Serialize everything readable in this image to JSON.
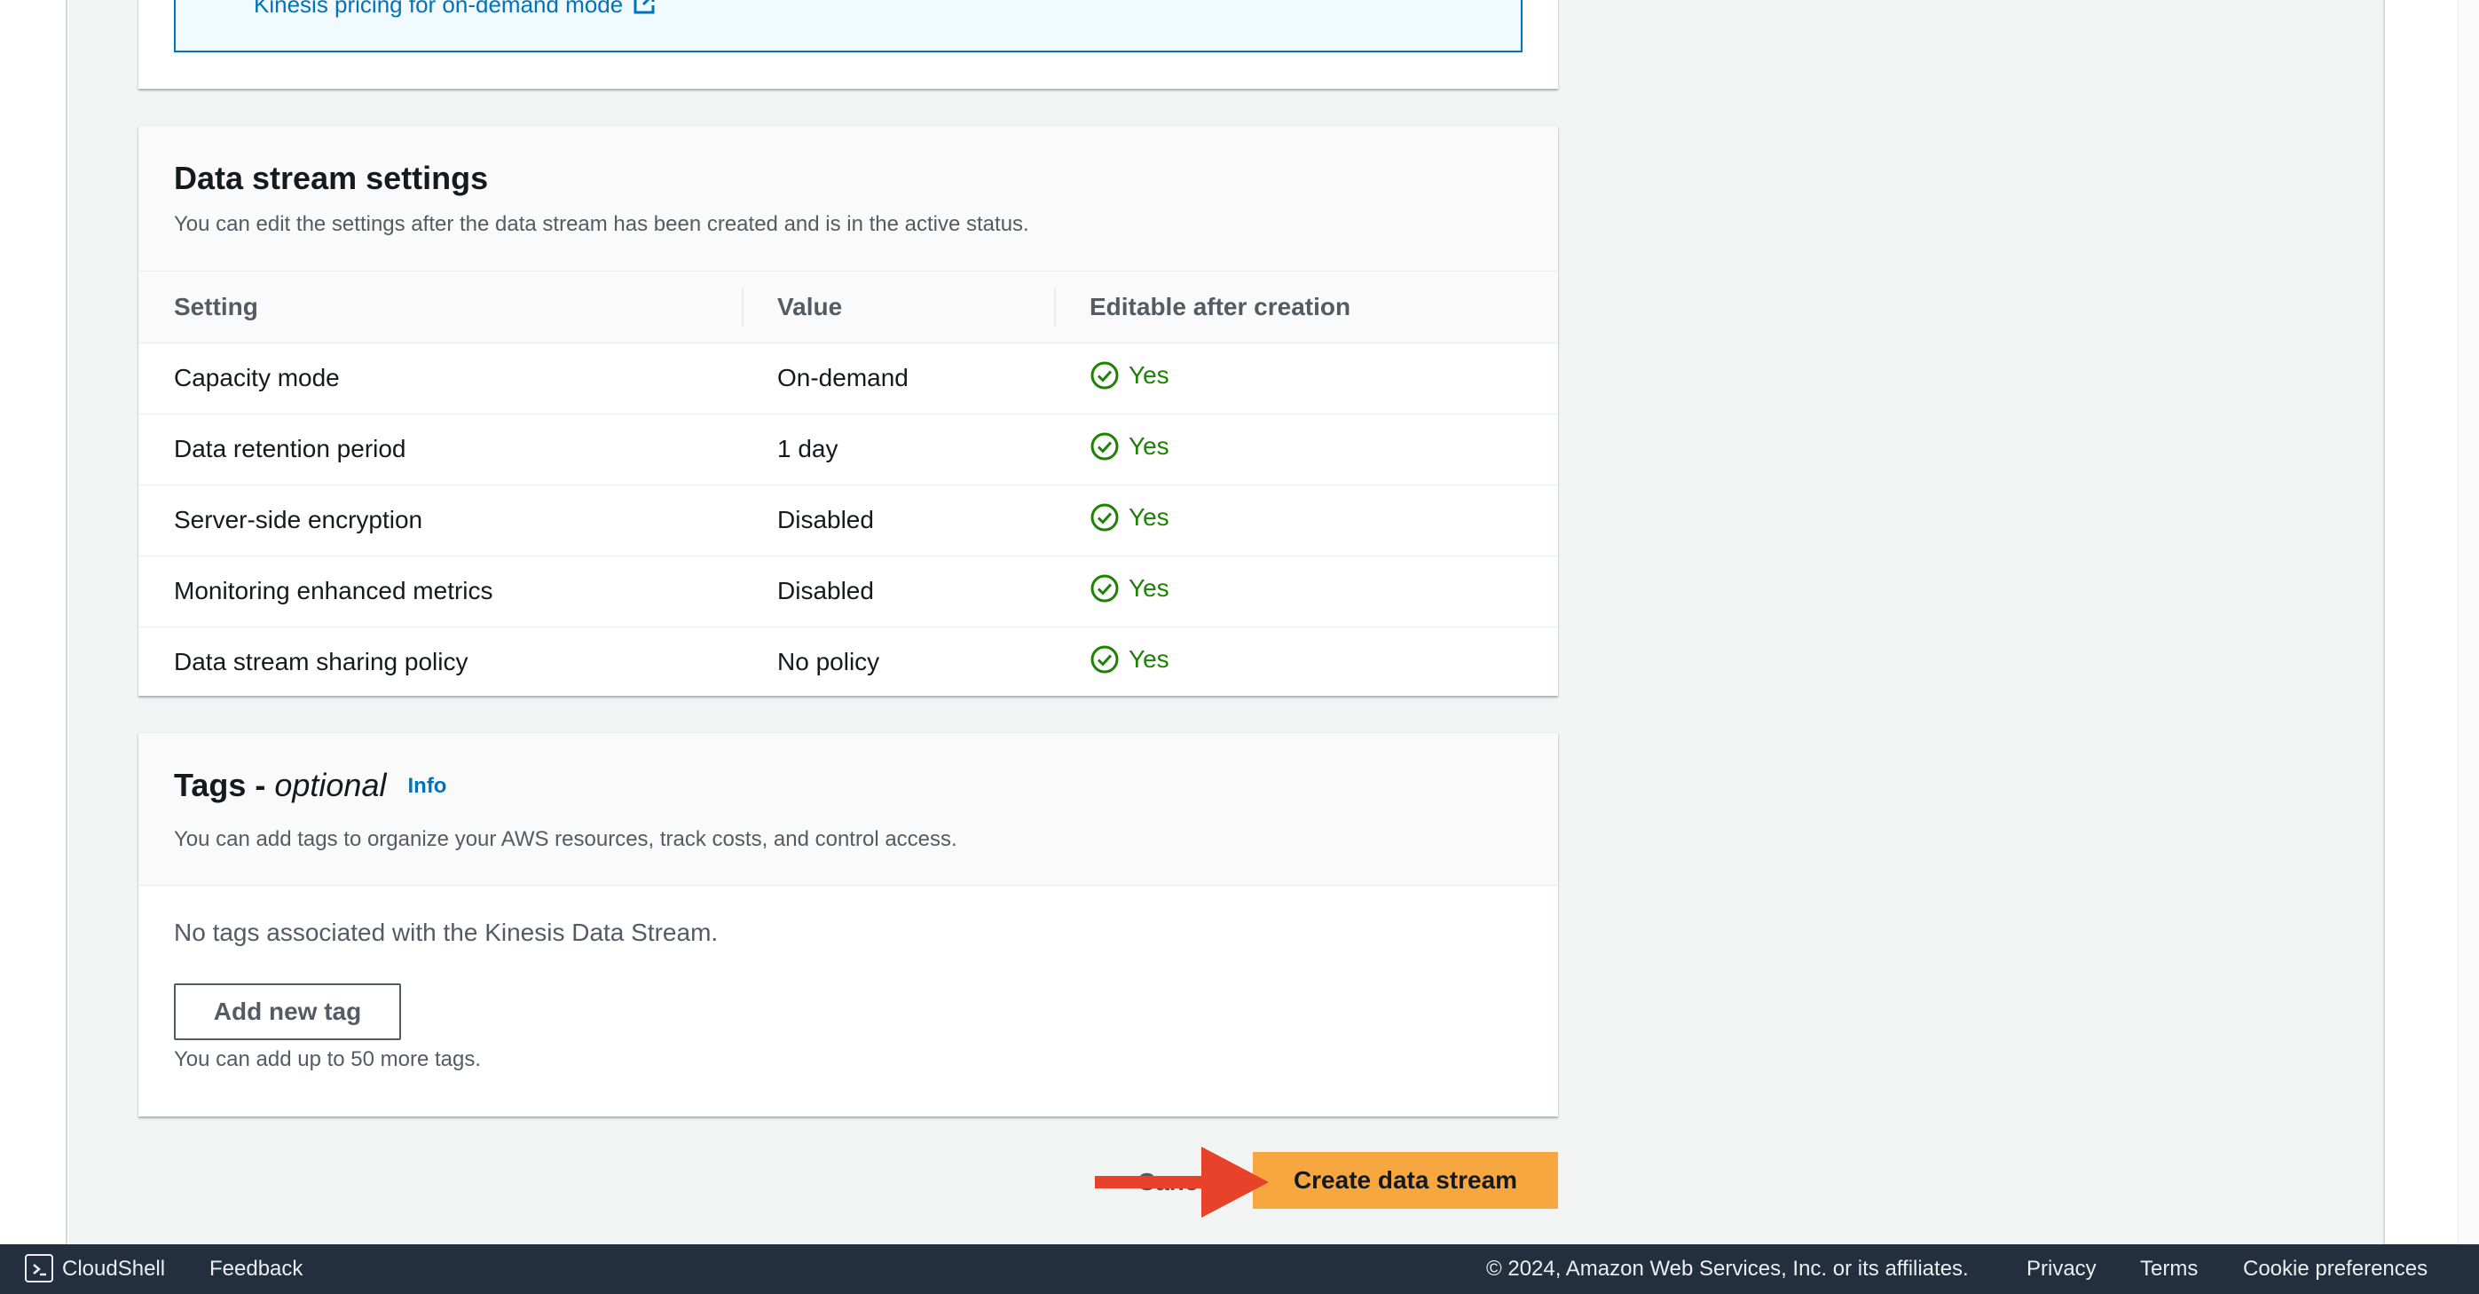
{
  "pricing": {
    "link_text": "Kinesis pricing for on-demand mode"
  },
  "settings": {
    "title": "Data stream settings",
    "description": "You can edit the settings after the data stream has been created and is in the active status.",
    "columns": [
      "Setting",
      "Value",
      "Editable after creation"
    ],
    "rows": [
      {
        "setting": "Capacity mode",
        "value": "On-demand",
        "editable": "Yes"
      },
      {
        "setting": "Data retention period",
        "value": "1 day",
        "editable": "Yes"
      },
      {
        "setting": "Server-side encryption",
        "value": "Disabled",
        "editable": "Yes"
      },
      {
        "setting": "Monitoring enhanced metrics",
        "value": "Disabled",
        "editable": "Yes"
      },
      {
        "setting": "Data stream sharing policy",
        "value": "No policy",
        "editable": "Yes"
      }
    ]
  },
  "tags": {
    "title": "Tags -",
    "title_optional": "optional",
    "info_link": "Info",
    "description": "You can add tags to organize your AWS resources, track costs, and control access.",
    "empty_text": "No tags associated with the Kinesis Data Stream.",
    "add_button": "Add new tag",
    "hint": "You can add up to 50 more tags."
  },
  "actions": {
    "cancel": "Cancel",
    "create": "Create data stream"
  },
  "footer": {
    "cloudshell": "CloudShell",
    "feedback": "Feedback",
    "copyright": "© 2024, Amazon Web Services, Inc. or its affiliates.",
    "privacy": "Privacy",
    "terms": "Terms",
    "cookies": "Cookie preferences"
  },
  "colors": {
    "link": "#0073bb",
    "success": "#1d8102",
    "primary_button": "#f7a740",
    "annotation_arrow": "#e8432a",
    "footer_bg": "#232f3e"
  }
}
